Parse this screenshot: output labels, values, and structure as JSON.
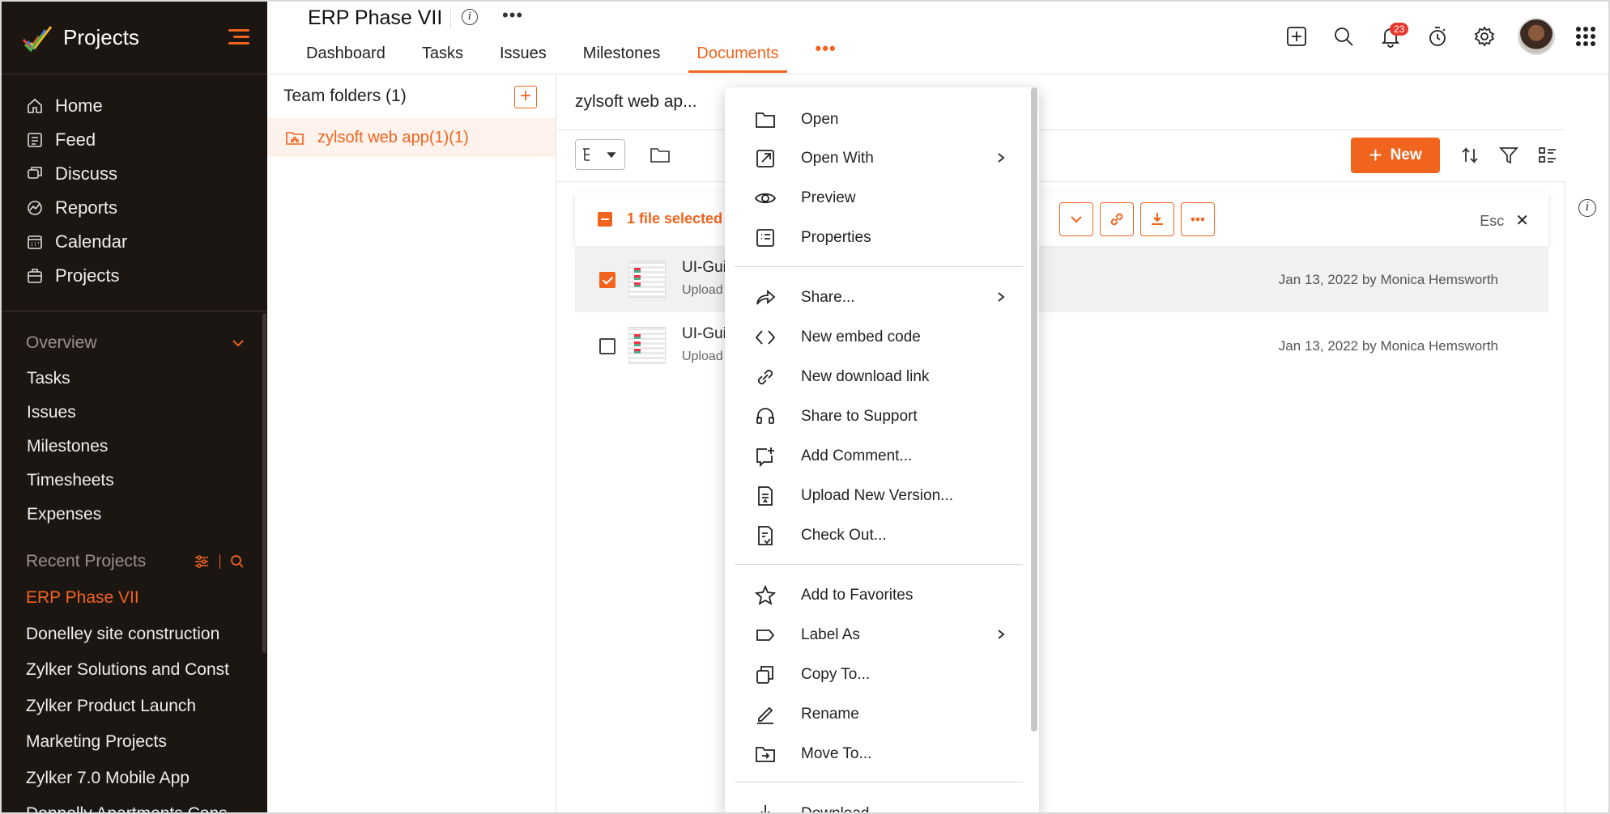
{
  "sidebar": {
    "app_name": "Projects",
    "nav": [
      {
        "label": "Home",
        "icon": "home-icon"
      },
      {
        "label": "Feed",
        "icon": "feed-icon"
      },
      {
        "label": "Discuss",
        "icon": "discuss-icon"
      },
      {
        "label": "Reports",
        "icon": "reports-icon"
      },
      {
        "label": "Calendar",
        "icon": "calendar-icon"
      },
      {
        "label": "Projects",
        "icon": "projects-icon"
      }
    ],
    "overview_label": "Overview",
    "overview_items": [
      "Tasks",
      "Issues",
      "Milestones",
      "Timesheets",
      "Expenses"
    ],
    "recent_label": "Recent Projects",
    "recent_items": [
      "ERP Phase VII",
      "Donelley site construction",
      "Zylker Solutions and Const",
      "Zylker Product Launch",
      "Marketing Projects",
      "Zylker 7.0 Mobile App",
      "Donnelly Apartments Cons"
    ]
  },
  "header": {
    "project_title": "ERP Phase VII",
    "tabs": [
      "Dashboard",
      "Tasks",
      "Issues",
      "Milestones",
      "Documents"
    ],
    "active_tab": "Documents",
    "more_label": "•••",
    "notification_count": "23"
  },
  "folders": {
    "heading": "Team folders (1)",
    "items": [
      {
        "label": "zylsoft web app(1)(1)"
      }
    ]
  },
  "main": {
    "breadcrumb": "zylsoft web ap...",
    "new_button": "New",
    "selection": {
      "text": "1 file selected",
      "esc_label": "Esc"
    },
    "rows": [
      {
        "name": "UI-Gui",
        "sub": "Upload",
        "date": "Jan 13, 2022 by Monica Hemsworth",
        "checked": true
      },
      {
        "name": "UI-Gui",
        "sub": "Upload",
        "date": "Jan 13, 2022 by Monica Hemsworth",
        "checked": false
      }
    ]
  },
  "context_menu": {
    "items": [
      {
        "label": "Open",
        "icon": "folder-open-icon"
      },
      {
        "label": "Open With",
        "icon": "open-external-icon",
        "submenu": true
      },
      {
        "label": "Preview",
        "icon": "eye-icon"
      },
      {
        "label": "Properties",
        "icon": "properties-icon"
      },
      {
        "label": "Share...",
        "icon": "share-icon",
        "submenu": true
      },
      {
        "label": "New embed code",
        "icon": "code-icon"
      },
      {
        "label": "New download link",
        "icon": "link-icon"
      },
      {
        "label": "Share to Support",
        "icon": "headset-icon"
      },
      {
        "label": "Add Comment...",
        "icon": "comment-add-icon"
      },
      {
        "label": "Upload New Version...",
        "icon": "upload-version-icon"
      },
      {
        "label": "Check Out...",
        "icon": "checkout-icon"
      },
      {
        "label": "Add to Favorites",
        "icon": "star-icon"
      },
      {
        "label": "Label As",
        "icon": "label-icon",
        "submenu": true
      },
      {
        "label": "Copy To...",
        "icon": "copy-icon"
      },
      {
        "label": "Rename",
        "icon": "pencil-icon"
      },
      {
        "label": "Move To...",
        "icon": "move-folder-icon"
      },
      {
        "label": "Download",
        "icon": "download-icon"
      }
    ]
  },
  "colors": {
    "accent": "#f0641e",
    "sidebar_bg": "#1c1613",
    "badge": "#e8372c"
  }
}
